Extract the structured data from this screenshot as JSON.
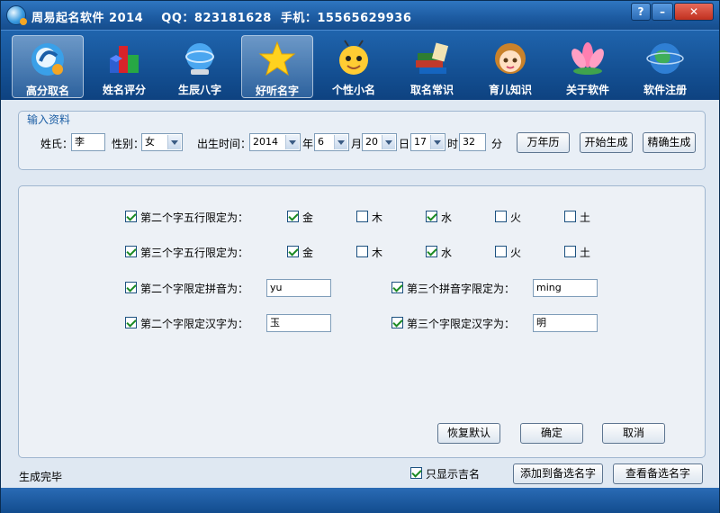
{
  "titlebar": {
    "text": "周易起名软件 2014    QQ：823181628  手机：15565629936",
    "help": "?",
    "minimize": "–",
    "close": "✕"
  },
  "toolbar": {
    "items": [
      {
        "label": "高分取名",
        "icon": "logo-icon",
        "active": true
      },
      {
        "label": "姓名评分",
        "icon": "cubes-chart-icon"
      },
      {
        "label": "生辰八字",
        "icon": "globe-icon"
      },
      {
        "label": "好听名字",
        "icon": "star-icon",
        "active": true
      },
      {
        "label": "个性小名",
        "icon": "cartoon-bee-icon"
      },
      {
        "label": "取名常识",
        "icon": "books-icon"
      },
      {
        "label": "育儿知识",
        "icon": "girl-icon"
      },
      {
        "label": "关于软件",
        "icon": "lotus-icon"
      },
      {
        "label": "软件注册",
        "icon": "earth-icon"
      }
    ]
  },
  "input": {
    "group_title": "输入资料",
    "surname_label": "姓氏：",
    "surname": "李",
    "gender_label": "性别：",
    "gender": "女",
    "birth_label": "出生时间：",
    "year": "2014",
    "year_unit": "年",
    "month": "6",
    "month_unit": "月",
    "day": "20",
    "day_unit": "日",
    "hour": "17",
    "hour_unit": "时",
    "minute": "32",
    "minute_unit": "分",
    "calendar_button": "万年历",
    "start_button": "开始生成",
    "precise_button": "精确生成"
  },
  "filters": {
    "second_wuxing_label": "第二个字五行限定为：",
    "third_wuxing_label": "第三个字五行限定为：",
    "elements": [
      "金",
      "木",
      "水",
      "火",
      "土"
    ],
    "second_wuxing_checked": [
      true,
      false,
      true,
      false,
      false
    ],
    "third_wuxing_checked": [
      true,
      false,
      true,
      false,
      false
    ],
    "second_pinyin_label": "第二个字限定拼音为：",
    "second_pinyin": "yu",
    "third_pinyin_label": "第三个拼音字限定为：",
    "third_pinyin": "ming",
    "second_hanzi_label": "第二个字限定汉字为：",
    "second_hanzi": "玉",
    "third_hanzi_label": "第三个字限定汉字为：",
    "third_hanzi": "明",
    "restore_button": "恢复默认",
    "ok_button": "确定",
    "cancel_button": "取消"
  },
  "status": {
    "text": "生成完毕",
    "only_lucky_label": "只显示吉名",
    "add_button": "添加到备选名字",
    "view_button": "查看备选名字"
  }
}
